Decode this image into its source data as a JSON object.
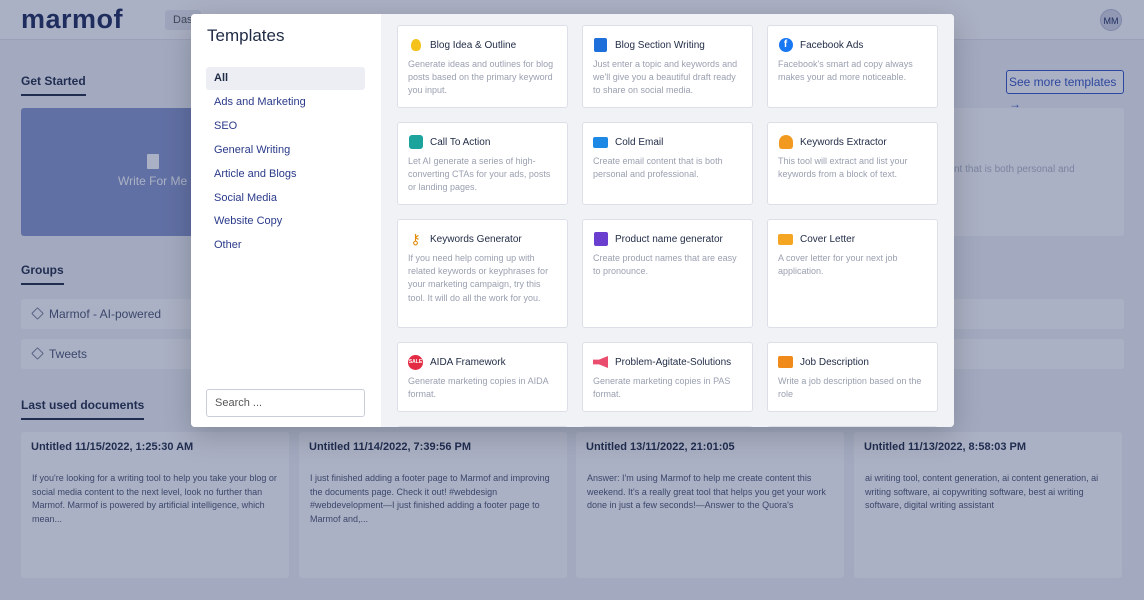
{
  "app": {
    "logo": "marmof",
    "nav_pill": "Das",
    "avatar": "MM"
  },
  "dashboard": {
    "get_started": "Get Started",
    "see_more": "See more templates",
    "write_for_me": "Write For Me",
    "right_card_text": "nt that is both personal and",
    "groups_title": "Groups",
    "groups": [
      "Marmof - AI-powered",
      "Tweets"
    ],
    "last_used_title": "Last used documents",
    "documents": [
      {
        "title": "Untitled 11/15/2022, 1:25:30 AM",
        "body": "If you're looking for a writing tool to help you take your blog or social media content to the next level, look no further than Marmof. Marmof is powered by artificial intelligence, which mean..."
      },
      {
        "title": "Untitled 11/14/2022, 7:39:56 PM",
        "body": "I just finished adding a footer page to Marmof and improving the documents page. Check it out! #webdesign #webdevelopment—I just finished adding a footer page to Marmof and,..."
      },
      {
        "title": "Untitled 13/11/2022, 21:01:05",
        "body": "Answer: I'm using Marmof to help me create content this weekend. It's a really great tool that helps you get your work done in just a few seconds!—Answer to the Quora's"
      },
      {
        "title": "Untitled 11/13/2022, 8:58:03 PM",
        "body": "ai writing tool, content generation, ai content generation, ai writing software, ai copywriting software, best ai writing software, digital writing assistant"
      }
    ]
  },
  "modal": {
    "title": "Templates",
    "categories": [
      "All",
      "Ads and Marketing",
      "SEO",
      "General Writing",
      "Article and Blogs",
      "Social Media",
      "Website Copy",
      "Other"
    ],
    "active_category": "All",
    "search_placeholder": "Search ...",
    "templates": [
      {
        "name": "Blog Idea & Outline",
        "desc": "Generate ideas and outlines for blog posts based on the primary keyword you input.",
        "icon": "lightbulb-icon"
      },
      {
        "name": "Blog Section Writing",
        "desc": "Just enter a topic and keywords and we'll give you a beautiful draft ready to share on social media.",
        "icon": "blog-icon"
      },
      {
        "name": "Facebook Ads",
        "desc": "Facebook's smart ad copy always makes your ad more noticeable.",
        "icon": "facebook-icon"
      },
      {
        "name": "Call To Action",
        "desc": "Let AI generate a series of high-converting CTAs for your ads, posts or landing pages.",
        "icon": "cta-icon"
      },
      {
        "name": "Cold Email",
        "desc": "Create email content that is both personal and professional.",
        "icon": "email-icon"
      },
      {
        "name": "Keywords Extractor",
        "desc": "This tool will extract and list your keywords from a block of text.",
        "icon": "keywords-extractor-icon"
      },
      {
        "name": "Keywords Generator",
        "desc": "If you need help coming up with related keywords or keyphrases for your marketing campaign, try this tool. It will do all the work for you.",
        "icon": "key-icon"
      },
      {
        "name": "Product name generator",
        "desc": "Create product names that are easy to pronounce.",
        "icon": "product-icon"
      },
      {
        "name": "Cover Letter",
        "desc": "A cover letter for your next job application.",
        "icon": "envelope-icon"
      },
      {
        "name": "AIDA Framework",
        "desc": "Generate marketing copies in AIDA format.",
        "icon": "sale-badge-icon"
      },
      {
        "name": "Problem-Agitate-Solutions",
        "desc": "Generate marketing copies in PAS format.",
        "icon": "megaphone-icon"
      },
      {
        "name": "Job Description",
        "desc": "Write a job description based on the role",
        "icon": "briefcase-icon"
      }
    ]
  },
  "colors": {
    "brand": "#1d2a5b",
    "accent": "#3453c2",
    "overlay": "#233164"
  }
}
